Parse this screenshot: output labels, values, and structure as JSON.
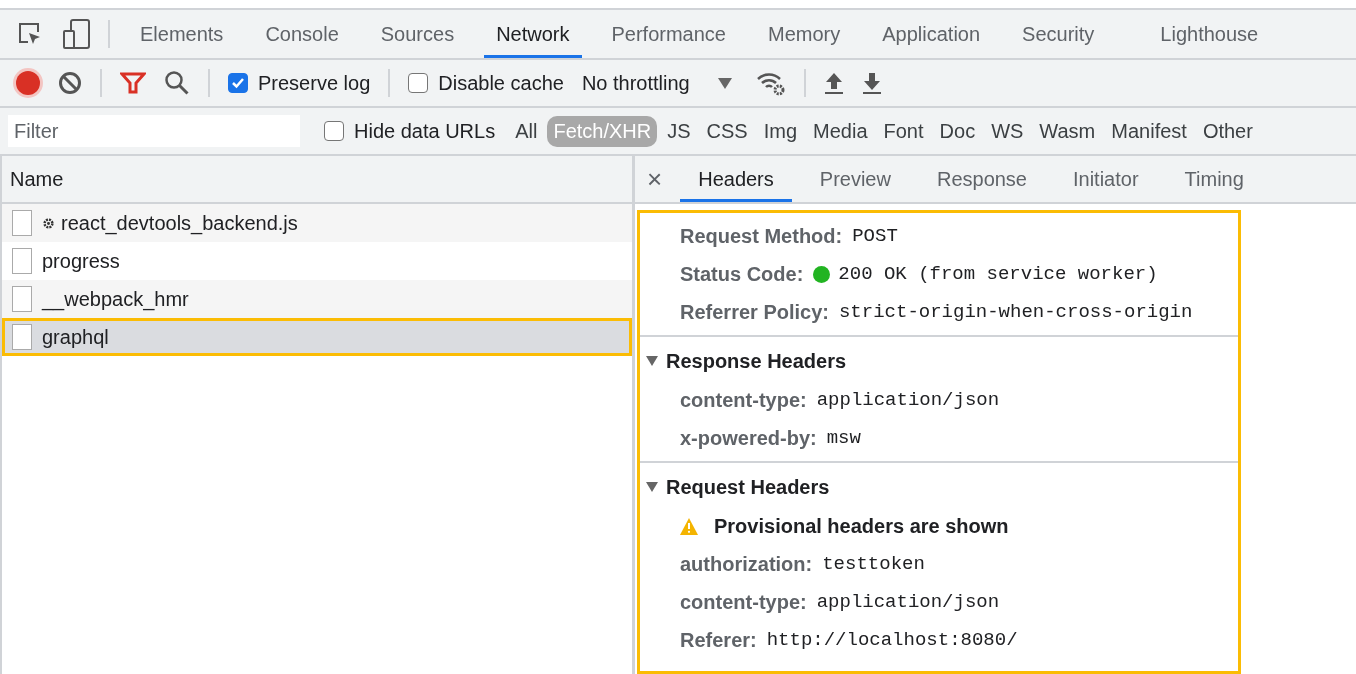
{
  "main_tabs": [
    {
      "label": "Elements",
      "selected": false
    },
    {
      "label": "Console",
      "selected": false
    },
    {
      "label": "Sources",
      "selected": false
    },
    {
      "label": "Network",
      "selected": true
    },
    {
      "label": "Performance",
      "selected": false
    },
    {
      "label": "Memory",
      "selected": false
    },
    {
      "label": "Application",
      "selected": false
    },
    {
      "label": "Security",
      "selected": false
    },
    {
      "label": "Lighthouse",
      "selected": false
    }
  ],
  "toolbar": {
    "recording": true,
    "preserve_log": {
      "label": "Preserve log",
      "checked": true
    },
    "disable_cache": {
      "label": "Disable cache",
      "checked": false
    },
    "throttling": "No throttling"
  },
  "filter_bar": {
    "placeholder": "Filter",
    "hide_data_urls": {
      "label": "Hide data URLs",
      "checked": false
    },
    "types": [
      {
        "label": "All",
        "selected": false
      },
      {
        "label": "Fetch/XHR",
        "selected": true
      },
      {
        "label": "JS",
        "selected": false
      },
      {
        "label": "CSS",
        "selected": false
      },
      {
        "label": "Img",
        "selected": false
      },
      {
        "label": "Media",
        "selected": false
      },
      {
        "label": "Font",
        "selected": false
      },
      {
        "label": "Doc",
        "selected": false
      },
      {
        "label": "WS",
        "selected": false
      },
      {
        "label": "Wasm",
        "selected": false
      },
      {
        "label": "Manifest",
        "selected": false
      },
      {
        "label": "Other",
        "selected": false
      }
    ]
  },
  "requests": {
    "column": "Name",
    "rows": [
      {
        "name": "react_devtools_backend.js",
        "kind": "extension",
        "selected": false,
        "highlighted": false
      },
      {
        "name": "progress",
        "kind": "plain",
        "selected": false,
        "highlighted": false
      },
      {
        "name": "__webpack_hmr",
        "kind": "plain",
        "selected": false,
        "highlighted": false
      },
      {
        "name": "graphql",
        "kind": "plain",
        "selected": true,
        "highlighted": true
      }
    ]
  },
  "details": {
    "close": "×",
    "tabs": [
      {
        "label": "Headers",
        "selected": true
      },
      {
        "label": "Preview",
        "selected": false
      },
      {
        "label": "Response",
        "selected": false
      },
      {
        "label": "Initiator",
        "selected": false
      },
      {
        "label": "Timing",
        "selected": false
      }
    ],
    "highlighted": true,
    "general": [
      {
        "name": "Request Method:",
        "value": "POST"
      },
      {
        "name": "Status Code:",
        "value": "200 OK (from service worker)",
        "color": "#22b422"
      },
      {
        "name": "Referrer Policy:",
        "value": "strict-origin-when-cross-origin"
      }
    ],
    "sections": [
      {
        "title": "Response Headers",
        "expanded": true,
        "headers": [
          {
            "name": "content-type:",
            "value": "application/json"
          },
          {
            "name": "x-powered-by:",
            "value": "msw"
          }
        ]
      },
      {
        "title": "Request Headers",
        "expanded": true,
        "warning": "Provisional headers are shown",
        "headers": [
          {
            "name": "authorization:",
            "value": "testtoken"
          },
          {
            "name": "content-type:",
            "value": "application/json"
          },
          {
            "name": "Referer:",
            "value": "http://localhost:8080/"
          }
        ]
      }
    ]
  }
}
